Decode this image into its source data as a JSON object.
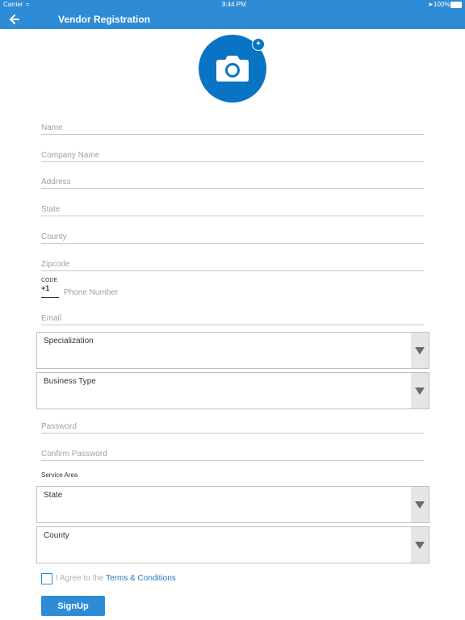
{
  "status_bar": {
    "carrier": "Carrier",
    "time": "9:44 PM",
    "battery": "100%"
  },
  "nav": {
    "title": "Vendor Registration",
    "back_icon": "arrow-left-icon"
  },
  "avatar": {
    "icon": "camera-icon",
    "badge": "+"
  },
  "fields": {
    "name": "Name",
    "company_name": "Company Name",
    "address": "Address",
    "state": "State",
    "county": "County",
    "zipcode": "Zipcode",
    "code_label": "CODE",
    "code_value": "+1",
    "phone": "Phone Number",
    "email": "Email",
    "password": "Password",
    "confirm_password": "Confirm Password"
  },
  "dropdowns": {
    "specialization": "Specialization",
    "business_type": "Business Type",
    "service_state": "State",
    "service_county": "County"
  },
  "service_area_label": "Service Area",
  "agree": {
    "prefix": "I Agree to the ",
    "link": "Terms & Conditions"
  },
  "signup_label": "SignUp",
  "colors": {
    "primary": "#2e8bd6",
    "avatar": "#0a74c4",
    "link": "#1f76c2"
  }
}
